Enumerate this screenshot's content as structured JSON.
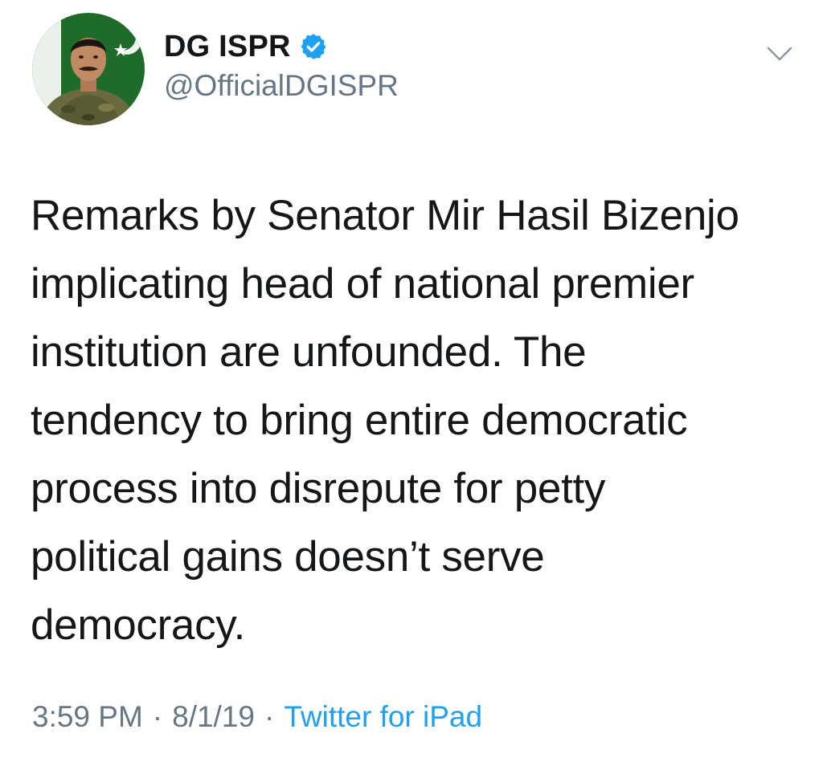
{
  "author": {
    "name": "DG ISPR",
    "handle": "@OfficialDGISPR",
    "verified": true
  },
  "tweet": {
    "text": "Remarks by Senator Mir Hasil Bizenjo\nimplicating head of national premier\ninstitution are unfounded. The\ntendency to bring entire democratic\nprocess into disrepute for petty\npolitical gains doesn’t serve\ndemocracy.",
    "time": "3:59 PM",
    "date": "8/1/19",
    "separator": "·",
    "source": "Twitter for iPad"
  },
  "colors": {
    "text": "#14171a",
    "secondary": "#657786",
    "link": "#1da1f2",
    "verified_badge": "#1da1f2",
    "flag_green": "#01411c"
  },
  "icons": {
    "verified": "verified-badge-icon",
    "menu": "chevron-down-icon"
  }
}
